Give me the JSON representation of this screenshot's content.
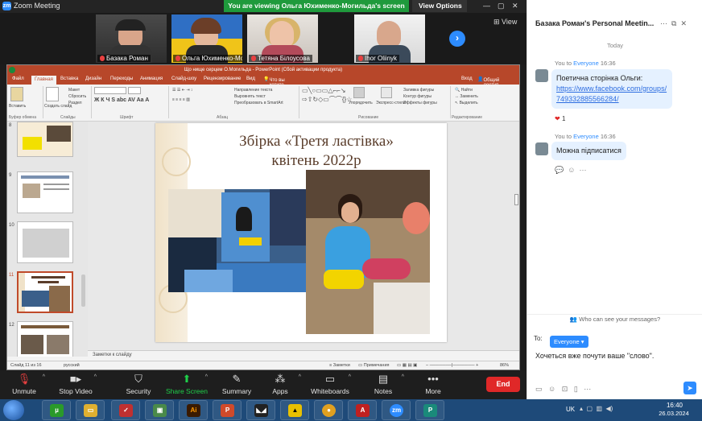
{
  "zoom": {
    "title": "Zoom Meeting",
    "viewing_banner": "You are viewing Ольга Юхименко-Могильда's screen",
    "view_options": "View Options",
    "view_label": "View",
    "participants": [
      {
        "name": "Базака Роман"
      },
      {
        "name": "Ольга Юхименко-Моги..."
      },
      {
        "name": "Тетяна Білоусова"
      },
      {
        "name": "Ihor Oliinyk"
      }
    ]
  },
  "ppt": {
    "window_title": "Що нище серцем О.Могильда - PowerPoint (Сбой активации продукта)",
    "tabs": [
      "Файл",
      "Главная",
      "Вставка",
      "Дизайн",
      "Переходы",
      "Анимация",
      "Слайд-шоу",
      "Рецензирование",
      "Вид",
      "Что вы хотите сделать?",
      "Вход",
      "Общий доступ"
    ],
    "active_tab": "Главная",
    "ribbon_groups": [
      "Буфер обмена",
      "Слайды",
      "Шрифт",
      "Абзац",
      "Рисование",
      "Редактирование"
    ],
    "ribbon_items": {
      "paste": "Вставить",
      "create_slide": "Создать слайд",
      "layout": "Макет",
      "reset": "Сбросить",
      "section": "Раздел",
      "text_direction": "Направление текста",
      "align_text": "Выровнять текст",
      "smartart": "Преобразовать в SmartArt",
      "arrange": "Упорядочить",
      "quick_styles": "Экспресс-стили",
      "shape_fill": "Заливка фигуры",
      "shape_outline": "Контур фигуры",
      "shape_effects": "Эффекты фигуры",
      "find": "Найти",
      "replace": "Заменить",
      "select": "Выделить"
    },
    "thumb_numbers": [
      "8",
      "9",
      "10",
      "11",
      "12"
    ],
    "slide": {
      "title_line1": "Збірка «Третя ластівка»",
      "title_line2": "квітень 2022р"
    },
    "notes_placeholder": "Заметки к слайду",
    "status": {
      "slide_info": "Слайд 11 из 16",
      "language": "русский",
      "notes": "Заметки",
      "comments": "Примечания",
      "zoom": "86%"
    }
  },
  "toolbar": {
    "unmute": "Unmute",
    "stop_video": "Stop Video",
    "security": "Security",
    "share_screen": "Share Screen",
    "summary": "Summary",
    "apps": "Apps",
    "whiteboards": "Whiteboards",
    "notes": "Notes",
    "more": "More",
    "end": "End"
  },
  "chat": {
    "header": "Базака Роман's Personal Meetin...",
    "today": "Today",
    "messages": [
      {
        "from": "You",
        "to": "Everyone",
        "time": "16:36",
        "text": "Поетична сторінка Ольги:",
        "link": "https://www.facebook.com/groups/749332885566284/"
      },
      {
        "from": "You",
        "to": "Everyone",
        "time": "16:36",
        "text": "Можна підписатися"
      }
    ],
    "reaction_count": "1",
    "who_can_see": "Who can see your messages?",
    "to_label": "To:",
    "to_value": "Everyone",
    "input_text": "Хочеться вже почути ваше \"слово\"."
  },
  "taskbar": {
    "lang": "UK",
    "time": "16:40",
    "date": "26.03.2024"
  },
  "colors": {
    "zoom_blue": "#2d8cff",
    "ppt_red": "#b7472a",
    "share_green": "#1fcf4a",
    "end_red": "#e02828",
    "banner_green": "#1f9a3c"
  }
}
